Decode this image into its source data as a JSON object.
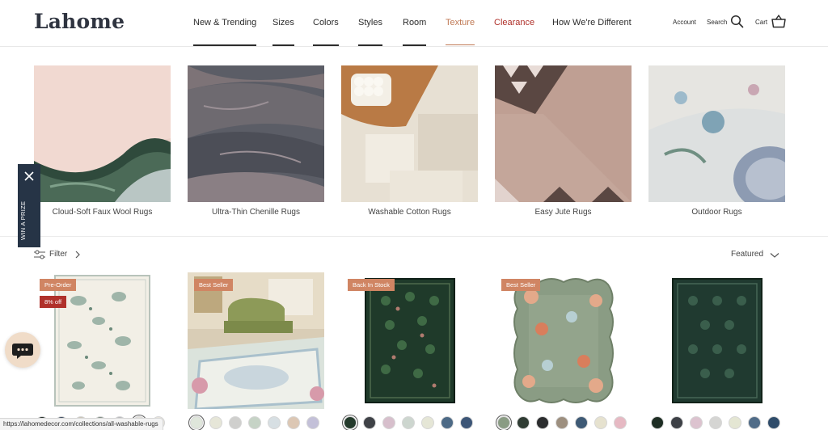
{
  "header": {
    "logo": "Lahome",
    "nav": [
      {
        "label": "New & Trending"
      },
      {
        "label": "Sizes"
      },
      {
        "label": "Colors"
      },
      {
        "label": "Styles"
      },
      {
        "label": "Room"
      },
      {
        "label": "Texture"
      },
      {
        "label": "Clearance"
      },
      {
        "label": "How We're Different"
      }
    ],
    "account_label": "Account",
    "search_label": "Search",
    "cart_label": "Cart"
  },
  "categories": [
    {
      "label": "Cloud-Soft Faux Wool Rugs"
    },
    {
      "label": "Ultra-Thin Chenille Rugs"
    },
    {
      "label": "Washable Cotton Rugs"
    },
    {
      "label": "Easy Jute Rugs"
    },
    {
      "label": "Outdoor Rugs"
    }
  ],
  "filter_label": "Filter",
  "sort_label": "Featured",
  "products": [
    {
      "badges": [
        "Pre-Order",
        "8% off"
      ]
    },
    {
      "badges": [
        "Best Seller"
      ]
    },
    {
      "badges": [
        "Back In Stock"
      ]
    },
    {
      "badges": [
        "Best Seller"
      ]
    },
    {
      "badges": []
    }
  ],
  "prize_label": "WIN A PRIZE",
  "status_url": "https://lahomedecor.com/collections/all-washable-rugs",
  "colors": {
    "accent": "#c07a55",
    "clearance": "#b0312b",
    "badge": "#d08563",
    "prize_bg": "#263446",
    "chat_bg": "#f0dcc8"
  }
}
